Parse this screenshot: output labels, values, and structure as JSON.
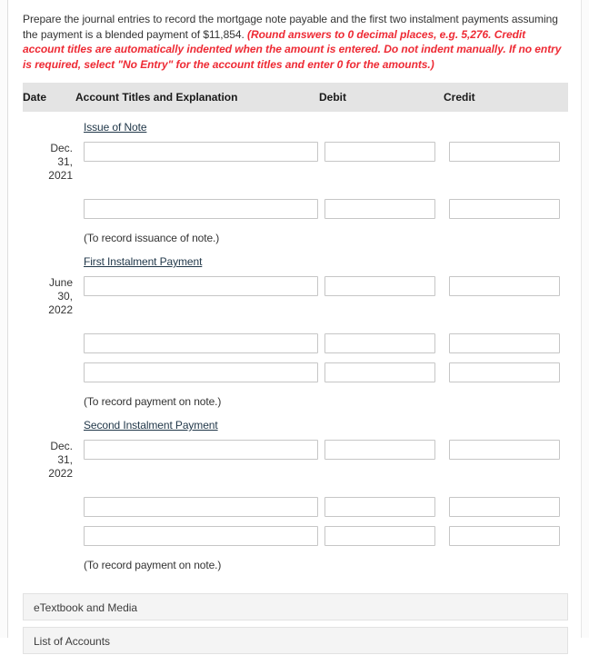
{
  "prompt": {
    "main": "Prepare the journal entries to record the mortgage note payable and the first two instalment payments assuming the payment is a blended payment of $11,854. ",
    "note": "(Round answers to 0 decimal places, e.g. 5,276. Credit account titles are automatically indented when the amount is entered. Do not indent manually. If no entry is required, select \"No Entry\" for the account titles and enter 0 for the amounts.)",
    "note_color": "#ee2a34"
  },
  "table": {
    "headers": {
      "date": "Date",
      "account": "Account Titles and Explanation",
      "debit": "Debit",
      "credit": "Credit"
    },
    "header_bg": "#e4e4e4",
    "sections": [
      {
        "label": "Issue of Note",
        "date": "Dec. 31, 2021",
        "date_lines": [
          "Dec.",
          "31,",
          "2021"
        ],
        "rows": [
          {
            "account": "",
            "debit": "",
            "credit": ""
          },
          {
            "account": "",
            "debit": "",
            "credit": ""
          }
        ],
        "memo": "(To record issuance of note.)"
      },
      {
        "label": "First Instalment Payment",
        "date": "June 30, 2022",
        "date_lines": [
          "June",
          "30,",
          "2022"
        ],
        "rows": [
          {
            "account": "",
            "debit": "",
            "credit": ""
          },
          {
            "account": "",
            "debit": "",
            "credit": ""
          },
          {
            "account": "",
            "debit": "",
            "credit": ""
          }
        ],
        "memo": "(To record payment on note.)"
      },
      {
        "label": "Second Instalment Payment",
        "date": "Dec. 31, 2022",
        "date_lines": [
          "Dec.",
          "31,",
          "2022"
        ],
        "rows": [
          {
            "account": "",
            "debit": "",
            "credit": ""
          },
          {
            "account": "",
            "debit": "",
            "credit": ""
          },
          {
            "account": "",
            "debit": "",
            "credit": ""
          }
        ],
        "memo": "(To record payment on note.)"
      }
    ]
  },
  "panels": [
    {
      "label": "eTextbook and Media"
    },
    {
      "label": "List of Accounts"
    }
  ]
}
